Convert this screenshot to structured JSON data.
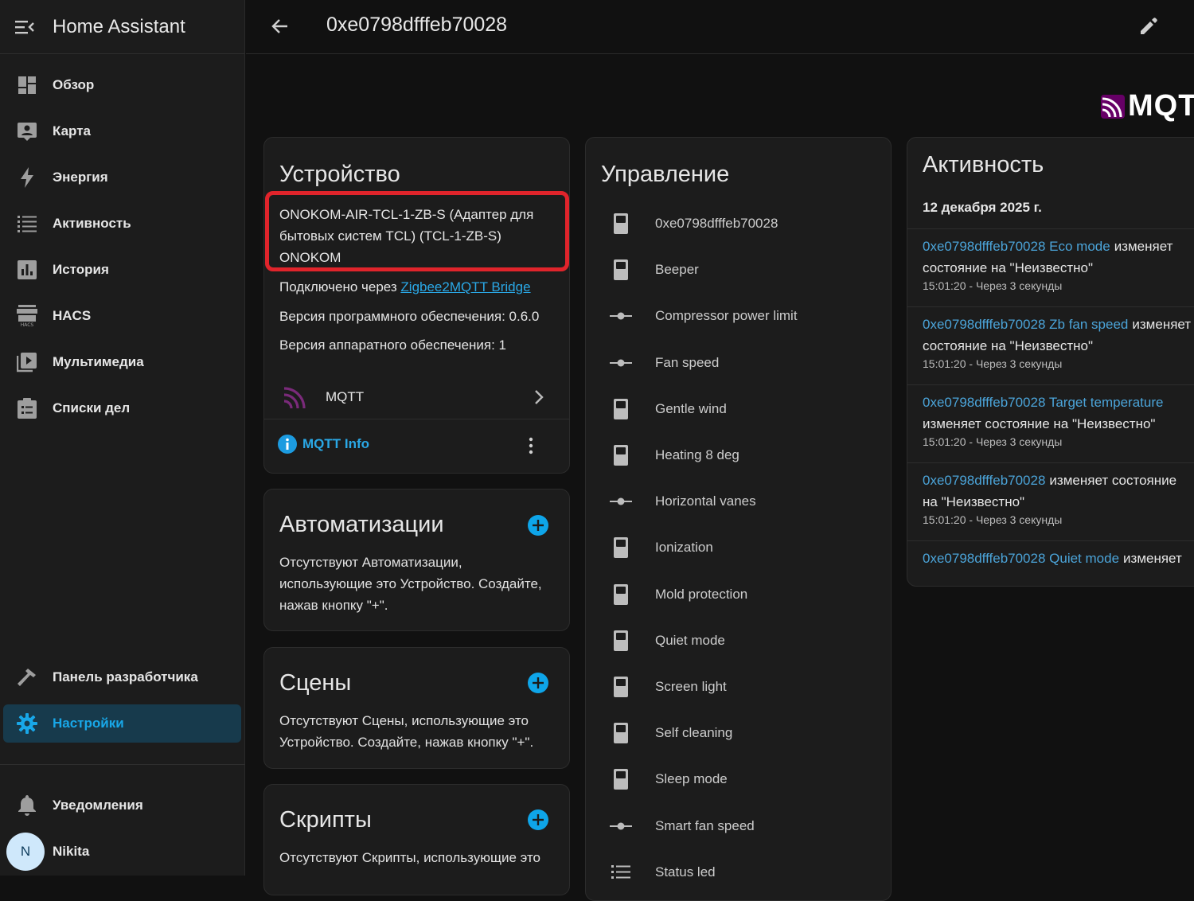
{
  "app": {
    "title": "Home Assistant"
  },
  "sidebar": {
    "items": [
      {
        "label": "Обзор",
        "icon": "dashboard-icon"
      },
      {
        "label": "Карта",
        "icon": "map-account-icon"
      },
      {
        "label": "Энергия",
        "icon": "lightning-icon"
      },
      {
        "label": "Активность",
        "icon": "format-list-icon"
      },
      {
        "label": "История",
        "icon": "chart-box-icon"
      },
      {
        "label": "HACS",
        "icon": "hacs-icon"
      },
      {
        "label": "Мультимедиа",
        "icon": "play-box-icon"
      },
      {
        "label": "Списки дел",
        "icon": "clipboard-list-icon"
      }
    ],
    "developer": {
      "label": "Панель разработчика",
      "icon": "hammer-icon"
    },
    "settings": {
      "label": "Настройки",
      "icon": "cog-icon"
    },
    "notifications": {
      "label": "Уведомления",
      "icon": "bell-icon"
    },
    "user": {
      "name": "Nikita",
      "initial": "N"
    }
  },
  "topbar": {
    "title": "0xe0798dfffeb70028"
  },
  "logo": {
    "text": "MQTT"
  },
  "device_card": {
    "title": "Устройство",
    "model_line1": "ONOKOM-AIR-TCL-1-ZB-S (Адаптер для",
    "model_line2": "бытовых систем TCL) (TCL-1-ZB-S)",
    "manufacturer": "ONOKOM",
    "via_label": "Подключено через",
    "via_link": "Zigbee2MQTT Bridge",
    "firmware": "Версия программного обеспечения: 0.6.0",
    "hardware": "Версия аппаратного обеспечения: 1",
    "integration": "MQTT",
    "info_link": "MQTT Info"
  },
  "automations": {
    "title": "Автоматизации",
    "text_line1": "Отсутствуют Автоматизации,",
    "text_line2": "использующие это Устройство. Создайте,",
    "text_line3": "нажав кнопку \"+\"."
  },
  "scenes": {
    "title": "Сцены",
    "text_line1": "Отсутствуют Сцены, использующие это",
    "text_line2": "Устройство. Создайте, нажав кнопку \"+\"."
  },
  "scripts": {
    "title": "Скрипты",
    "text_line1": "Отсутствуют Скрипты, использующие это"
  },
  "controls": {
    "title": "Управление",
    "items": [
      {
        "label": "0xe0798dfffeb70028",
        "icon": "switch-icon"
      },
      {
        "label": "Beeper",
        "icon": "switch-icon"
      },
      {
        "label": "Compressor power limit",
        "icon": "slider-icon"
      },
      {
        "label": "Fan speed",
        "icon": "slider-icon"
      },
      {
        "label": "Gentle wind",
        "icon": "switch-icon"
      },
      {
        "label": "Heating 8 deg",
        "icon": "switch-icon"
      },
      {
        "label": "Horizontal vanes",
        "icon": "slider-icon"
      },
      {
        "label": "Ionization",
        "icon": "switch-icon"
      },
      {
        "label": "Mold protection",
        "icon": "switch-icon"
      },
      {
        "label": "Quiet mode",
        "icon": "switch-icon"
      },
      {
        "label": "Screen light",
        "icon": "switch-icon"
      },
      {
        "label": "Self cleaning",
        "icon": "switch-icon"
      },
      {
        "label": "Sleep mode",
        "icon": "switch-icon"
      },
      {
        "label": "Smart fan speed",
        "icon": "slider-icon"
      },
      {
        "label": "Status led",
        "icon": "format-list-icon"
      }
    ]
  },
  "activity": {
    "title": "Активность",
    "date": "12 декабря 2025 г.",
    "entries": [
      {
        "entity": "0xe0798dfffeb70028 Eco mode",
        "action": "изменяет",
        "line2": "состояние на \"Неизвестно\"",
        "time": "15:01:20 - Через 3 секунды"
      },
      {
        "entity": "0xe0798dfffeb70028 Zb fan speed",
        "action": "изменяет",
        "line2": "состояние на \"Неизвестно\"",
        "time": "15:01:20 - Через 3 секунды"
      },
      {
        "entity": "0xe0798dfffeb70028 Target temperature",
        "action": "",
        "line2": "изменяет состояние на \"Неизвестно\"",
        "time": "15:01:20 - Через 3 секунды"
      },
      {
        "entity": "0xe0798dfffeb70028",
        "action": "изменяет состояние",
        "line2": "на \"Неизвестно\"",
        "time": "15:01:20 - Через 3 секунды"
      },
      {
        "entity": "0xe0798dfffeb70028 Quiet mode",
        "action": "изменяет",
        "line2": "",
        "time": ""
      }
    ]
  },
  "colors": {
    "accent": "#18a7e8",
    "highlight_box": "#e0242b",
    "link": "#2aa8e6",
    "mqtt_purple": "#660066"
  }
}
